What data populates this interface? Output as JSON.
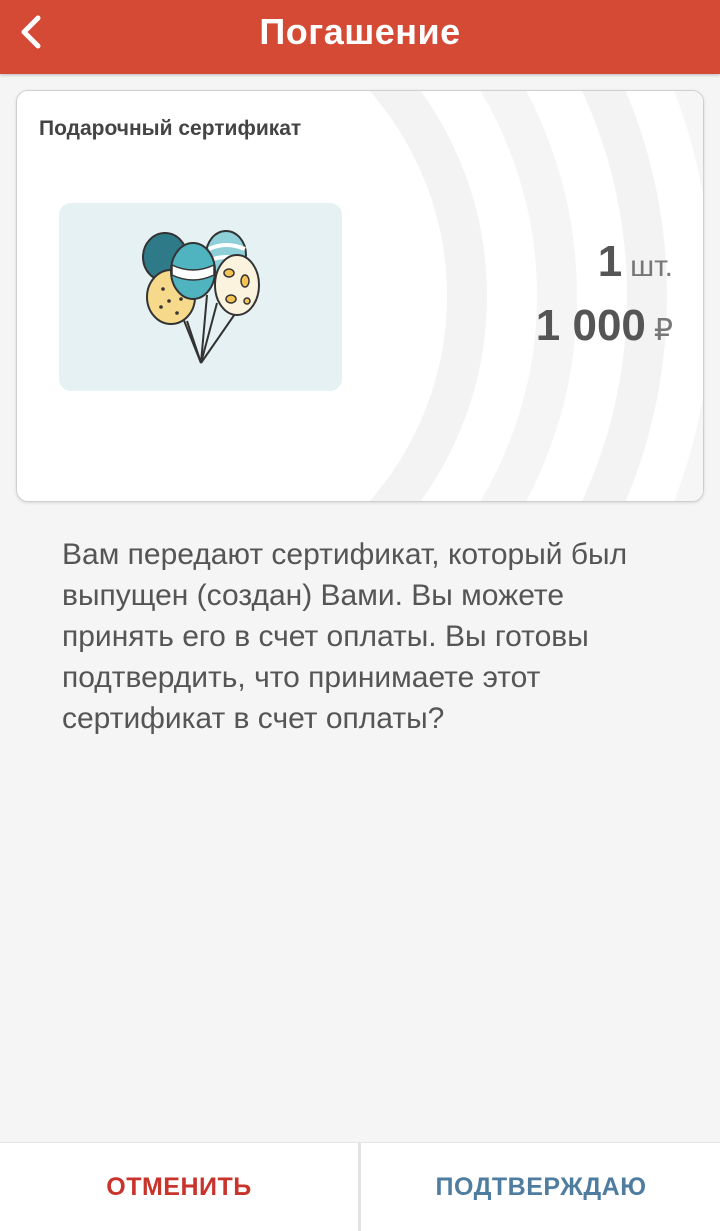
{
  "header": {
    "title": "Погашение",
    "back_icon": "chevron-left-icon",
    "color": "#d44a34"
  },
  "card": {
    "title": "Подарочный сертификат",
    "image_icon": "balloons-icon",
    "quantity": "1",
    "quantity_unit": "шт.",
    "amount": "1 000",
    "currency": "₽"
  },
  "message": "Вам передают сертификат, который был выпущен (создан) Вами. Вы можете принять его в счет оплаты. Вы готовы подтвердить, что принимаете этот сертификат в счет оплаты?",
  "footer": {
    "cancel_label": "ОТМЕНИТЬ",
    "confirm_label": "ПОДТВЕРЖДАЮ",
    "cancel_color": "#c8332b",
    "confirm_color": "#4f7da0"
  }
}
